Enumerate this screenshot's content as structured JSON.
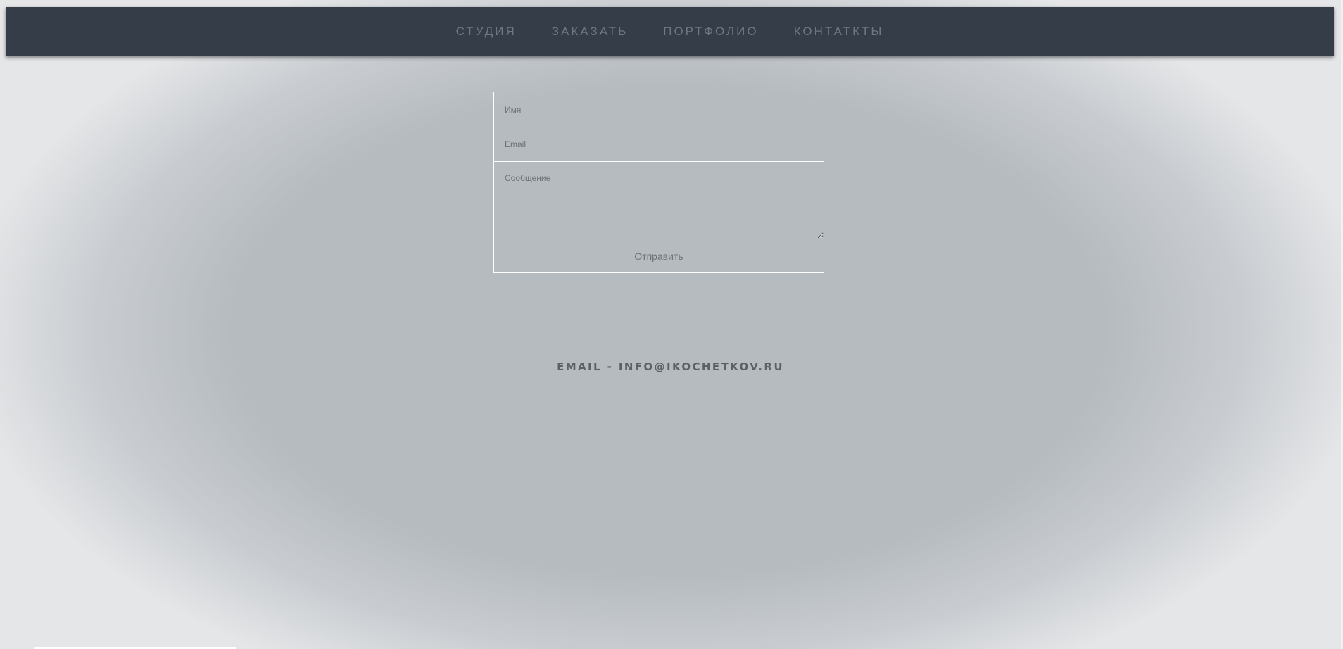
{
  "nav": {
    "items": [
      {
        "label": "СТУДИЯ"
      },
      {
        "label": "ЗАКАЗАТЬ"
      },
      {
        "label": "ПОРТФОЛИО"
      },
      {
        "label": "КОНТАТКТЫ"
      }
    ]
  },
  "form": {
    "name_placeholder": "Имя",
    "email_placeholder": "Email",
    "message_placeholder": "Сообщение",
    "submit_label": "Отправить"
  },
  "contact": {
    "email_line": "EMAIL - INFO@IKOCHETKOV.RU"
  },
  "colors": {
    "navbar_bg": "#343d48",
    "nav_text": "#6f7782",
    "page_bg": "#b6bbbf",
    "form_border": "#ffffff",
    "contact_text": "#5d6166"
  }
}
